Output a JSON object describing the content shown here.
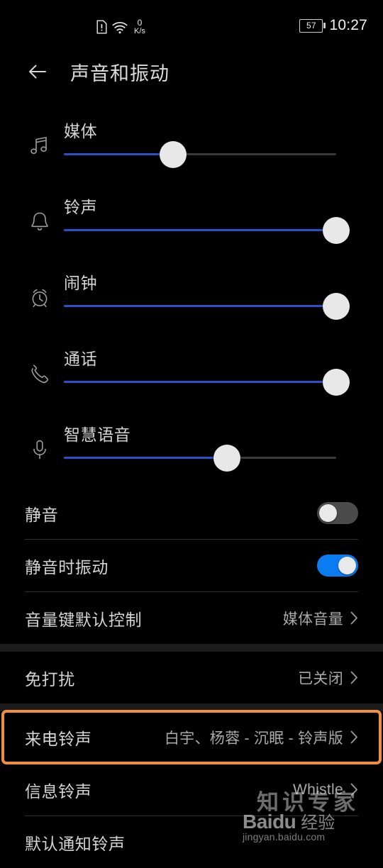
{
  "status_bar": {
    "sim_icon": "sim-alert-icon",
    "wifi_icon": "wifi-icon",
    "network_speed_value": "0",
    "network_speed_unit": "K/s",
    "battery_percent": "57",
    "time": "10:27"
  },
  "app_bar": {
    "back_icon": "back-arrow-icon",
    "title": "声音和振动"
  },
  "volume_sliders": [
    {
      "icon": "music-note-icon",
      "label": "媒体",
      "value": 40,
      "fill_color": "#2b50c8"
    },
    {
      "icon": "bell-icon",
      "label": "铃声",
      "value": 100,
      "fill_color": "#2b50c8"
    },
    {
      "icon": "alarm-clock-icon",
      "label": "闹钟",
      "value": 100,
      "fill_color": "#2b50c8"
    },
    {
      "icon": "phone-icon",
      "label": "通话",
      "value": 100,
      "fill_color": "#2b50c8"
    },
    {
      "icon": "microphone-icon",
      "label": "智慧语音",
      "value": 60,
      "fill_color": "#2b50c8"
    }
  ],
  "toggle_rows": [
    {
      "label": "静音",
      "state": "off",
      "state_label": "关"
    },
    {
      "label": "静音时振动",
      "state": "on",
      "state_label": "开"
    }
  ],
  "nav_rows": [
    {
      "label": "音量键默认控制",
      "value": "媒体音量"
    },
    {
      "label": "免打扰",
      "value": "已关闭"
    },
    {
      "label": "来电铃声",
      "value": "白宇、杨蓉 - 沉眠 - 铃声版",
      "highlighted": true
    },
    {
      "label": "信息铃声",
      "value": "Whistle"
    },
    {
      "label": "默认通知铃声",
      "value": ""
    }
  ],
  "highlight": {
    "color": "#ef8f41",
    "target": "来电铃声"
  },
  "watermark": {
    "top_text": "知识专家",
    "brand": "Baidu",
    "brand_cn": "经验",
    "url": "jingyan.baidu.com"
  }
}
